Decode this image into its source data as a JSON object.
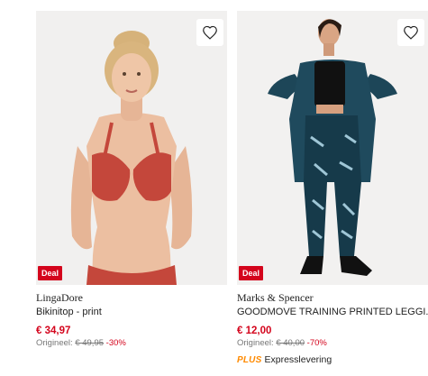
{
  "products": [
    {
      "brand": "LingaDore",
      "name": "Bikinitop - print",
      "badge": "Deal",
      "price": "€ 34,97",
      "original_label": "Origineel:",
      "original_price": "€ 49,95",
      "discount": "-30%",
      "wishlist_icon": "heart-outline-icon"
    },
    {
      "brand": "Marks & Spencer",
      "name": "GOODMOVE TRAINING PRINTED LEGGI...",
      "badge": "Deal",
      "price": "€ 12,00",
      "original_label": "Origineel:",
      "original_price": "€ 40,00",
      "discount": "-70%",
      "delivery_tag": "PLUS",
      "delivery_text": "Expresslevering",
      "wishlist_icon": "heart-outline-icon"
    }
  ],
  "colors": {
    "accent": "#d4041c",
    "plus": "#ff8a00",
    "image_bg": "#f1f1f1"
  }
}
